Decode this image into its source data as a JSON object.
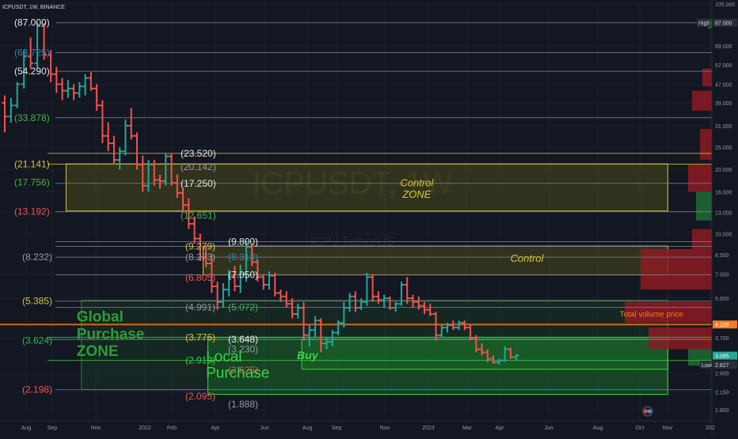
{
  "header": {
    "symbol_line": "ICPUSDT, 1W, BINANCE"
  },
  "watermark": {
    "title": "ICPUSDT, 1W",
    "subtitle": "ICP / TetherUS"
  },
  "colors": {
    "background": "#131722",
    "up": "#26a69a",
    "down": "#ef5350",
    "orange": "#f57c21",
    "yellow": "#d4c53a",
    "green": "#33d13f",
    "white": "#e6e6e6",
    "blue": "#2a8bb0"
  },
  "chart_data": {
    "type": "ohlc",
    "y_scale": "log",
    "ylim": [
      1.8,
      105
    ],
    "x_tick_labels": [
      "Aug",
      "Sep",
      "Nov",
      "2022",
      "Feb",
      "Apr",
      "Jun",
      "Aug",
      "Sep",
      "Nov",
      "2023",
      "Mar",
      "Apr",
      "Jun",
      "Aug",
      "Oct",
      "Nov",
      "202"
    ],
    "y_tick_labels": [
      "105.000",
      "69.000",
      "57.000",
      "47.000",
      "39.000",
      "31.000",
      "25.000",
      "20.000",
      "16.000",
      "13.000",
      "10.500",
      "8.500",
      "7.000",
      "5.500",
      "3.700",
      "2.600",
      "2.150",
      "1.800"
    ],
    "price_tags": [
      {
        "text": "High",
        "value": "87.000",
        "y": 87.0
      },
      {
        "text": "",
        "value": "4.229",
        "y": 4.229
      },
      {
        "text": "",
        "value": "3.095",
        "y": 3.095
      },
      {
        "text": "Low",
        "value": "2.827",
        "y": 2.827
      }
    ],
    "annotations": [
      {
        "text": "Control",
        "x": 5.45,
        "y": 8.2
      },
      {
        "text": "Total volume price",
        "x": 6.75,
        "y": 4.7
      },
      {
        "text": "Control",
        "x": 4.3,
        "y": 17.5
      },
      {
        "text": "ZONE",
        "x": 4.3,
        "y": 15.6
      },
      {
        "text": "Global",
        "x": 0.75,
        "y": 4.6
      },
      {
        "text": "Purchase",
        "x": 0.75,
        "y": 3.86
      },
      {
        "text": "ZONE",
        "x": 0.75,
        "y": 3.25
      },
      {
        "text": "Local",
        "x": 2.1,
        "y": 3.08
      },
      {
        "text": "Purchase",
        "x": 2.1,
        "y": 2.62
      },
      {
        "text": "Buy",
        "x": 3.05,
        "y": 3.11
      }
    ],
    "level_labels": [
      {
        "text": "(87.000)",
        "y": 87.0
      },
      {
        "text": "(63.725)",
        "y": 64.5
      },
      {
        "text": "(54.290)",
        "y": 53.5
      },
      {
        "text": "(33.878)",
        "y": 33.6
      },
      {
        "text": "(21.141)",
        "y": 21.1
      },
      {
        "text": "(17.756)",
        "y": 17.6
      },
      {
        "text": "(13.192)",
        "y": 13.1
      },
      {
        "text": "(8.232)",
        "y": 8.3
      },
      {
        "text": "(5.385)",
        "y": 5.35
      },
      {
        "text": "(3.624)",
        "y": 3.6
      },
      {
        "text": "(2.198)",
        "y": 2.2
      },
      {
        "text": "(23.520)",
        "y": 23.5
      },
      {
        "text": "(20.142)",
        "y": 20.5
      },
      {
        "text": "(17.250)",
        "y": 17.4
      },
      {
        "text": "(12.651)",
        "y": 12.6
      },
      {
        "text": "(9.800)",
        "y": 9.7
      },
      {
        "text": "(9.279)",
        "y": 9.25
      },
      {
        "text": "(8.273)",
        "y": 8.3
      },
      {
        "text": "(8.313)",
        "y": 8.3
      },
      {
        "text": "(7.050)",
        "y": 6.95
      },
      {
        "text": "(6.805)",
        "y": 6.75
      },
      {
        "text": "(4.991)",
        "y": 5.02
      },
      {
        "text": "(5.072)",
        "y": 5.02
      },
      {
        "text": "(3.776)",
        "y": 3.72
      },
      {
        "text": "(3.648)",
        "y": 3.64
      },
      {
        "text": "(3.230)",
        "y": 3.3
      },
      {
        "text": "(2.910)",
        "y": 2.95
      },
      {
        "text": "(2.625)",
        "y": 2.68
      },
      {
        "text": "(2.095)",
        "y": 2.06
      },
      {
        "text": "(1.888)",
        "y": 1.9
      }
    ],
    "levels": [
      87.0,
      64.5,
      53.5,
      33.6,
      23.5,
      21.1,
      17.4,
      13.1,
      9.7,
      9.25,
      8.3,
      6.95,
      5.35,
      5.02,
      4.229,
      3.72,
      3.64,
      2.95,
      2.2
    ],
    "zones": [
      {
        "x0": 0.64,
        "x1": 6.92,
        "y_high": 21.14,
        "y_low": 13.19,
        "color": "yellow"
      },
      {
        "x0": 2.07,
        "x1": 6.92,
        "y_high": 9.28,
        "y_low": 6.95,
        "color": "yellow"
      },
      {
        "x0": 0.8,
        "x1": 6.92,
        "y_high": 5.385,
        "y_low": 2.2,
        "color": "green-dark"
      },
      {
        "x0": 2.12,
        "x1": 6.92,
        "y_high": 3.72,
        "y_low": 2.1,
        "color": "green"
      },
      {
        "x0": 3.1,
        "x1": 6.92,
        "y_high": 3.65,
        "y_low": 2.7,
        "color": "green"
      }
    ],
    "volume_profile": [
      {
        "y_low": 82,
        "y_high": 90,
        "width": 5,
        "up": true
      },
      {
        "y_low": 46,
        "y_high": 55,
        "width": 12,
        "up": false
      },
      {
        "y_low": 36,
        "y_high": 44,
        "width": 25,
        "up": false
      },
      {
        "y_low": 22,
        "y_high": 30,
        "width": 15,
        "up": false
      },
      {
        "y_low": 16,
        "y_high": 21,
        "width": 30,
        "up": false
      },
      {
        "y_low": 12,
        "y_high": 16,
        "width": 20,
        "up": true
      },
      {
        "y_low": 9,
        "y_high": 11,
        "width": 25,
        "up": false
      },
      {
        "y_low": 6,
        "y_high": 9,
        "width": 90,
        "up": false
      },
      {
        "y_low": 4.3,
        "y_high": 5.3,
        "width": 110,
        "up": false
      },
      {
        "y_low": 3.3,
        "y_high": 4.1,
        "width": 80,
        "up": false
      },
      {
        "y_low": 2.8,
        "y_high": 3.3,
        "width": 30,
        "up": true
      }
    ],
    "bars": [
      [
        0,
        39,
        42,
        29,
        34
      ],
      [
        0.065,
        34,
        41,
        32,
        38
      ],
      [
        0.13,
        38,
        48,
        37,
        47
      ],
      [
        0.2,
        47,
        66,
        45,
        62
      ],
      [
        0.27,
        62,
        75,
        55,
        58
      ],
      [
        0.34,
        58,
        87,
        55,
        84
      ],
      [
        0.41,
        84,
        87,
        60,
        63
      ],
      [
        0.48,
        63,
        66,
        48,
        52
      ],
      [
        0.54,
        52,
        56,
        43,
        47
      ],
      [
        0.6,
        47,
        50,
        40,
        44
      ],
      [
        0.66,
        44,
        49,
        41,
        45
      ],
      [
        0.72,
        45,
        47,
        40,
        43
      ],
      [
        0.78,
        43,
        48,
        41,
        46
      ],
      [
        0.84,
        46,
        52,
        42,
        50
      ],
      [
        0.9,
        50,
        53,
        44,
        45
      ],
      [
        0.96,
        45,
        47,
        36,
        38
      ],
      [
        1.02,
        38,
        40,
        26,
        28
      ],
      [
        1.08,
        28,
        32,
        24,
        26
      ],
      [
        1.14,
        26,
        28,
        21,
        22
      ],
      [
        1.2,
        22,
        25,
        20,
        24
      ],
      [
        1.26,
        24,
        33,
        23,
        31
      ],
      [
        1.32,
        31,
        37,
        27,
        28
      ],
      [
        1.38,
        28,
        29,
        20,
        21
      ],
      [
        1.44,
        21,
        23,
        16,
        17
      ],
      [
        1.5,
        17,
        22,
        16,
        21
      ],
      [
        1.56,
        21,
        22,
        17,
        18
      ],
      [
        1.62,
        18,
        19,
        16.5,
        17.8
      ],
      [
        1.68,
        17.8,
        23.5,
        17,
        22.8
      ],
      [
        1.74,
        22.8,
        23.5,
        17,
        17.5
      ],
      [
        1.8,
        17.5,
        19,
        15,
        15.8
      ],
      [
        1.86,
        15.8,
        16.5,
        13,
        14
      ],
      [
        1.92,
        14,
        15,
        11,
        11.6
      ],
      [
        1.98,
        11.6,
        12.5,
        9.5,
        10
      ],
      [
        2.04,
        10,
        10.5,
        8,
        8.3
      ],
      [
        2.1,
        8.3,
        9.3,
        7.5,
        7.8
      ],
      [
        2.16,
        7.8,
        8.5,
        5.8,
        6.2
      ],
      [
        2.22,
        6.2,
        6.5,
        4.9,
        5.3
      ],
      [
        2.28,
        5.3,
        6.4,
        5.0,
        6.0
      ],
      [
        2.34,
        6.0,
        7.3,
        5.6,
        6.8
      ],
      [
        2.4,
        6.8,
        7.6,
        5.9,
        6.2
      ],
      [
        2.46,
        6.2,
        7.7,
        5.8,
        7.0
      ],
      [
        2.52,
        7.0,
        9.8,
        6.5,
        9.2
      ],
      [
        2.58,
        9.2,
        9.5,
        7.6,
        7.9
      ],
      [
        2.64,
        7.9,
        8.1,
        6.5,
        6.8
      ],
      [
        2.7,
        6.8,
        7.0,
        6.0,
        6.3
      ],
      [
        2.76,
        6.3,
        7.2,
        6.0,
        6.9
      ],
      [
        2.82,
        6.9,
        7.1,
        5.6,
        5.8
      ],
      [
        2.88,
        5.8,
        6.0,
        5.3,
        5.6
      ],
      [
        2.94,
        5.6,
        5.9,
        5.0,
        5.2
      ],
      [
        3.0,
        5.2,
        5.5,
        4.5,
        4.7
      ],
      [
        3.06,
        4.7,
        5.2,
        4.5,
        5.0
      ],
      [
        3.12,
        5.0,
        5.3,
        3.6,
        3.8
      ],
      [
        3.18,
        3.8,
        4.2,
        3.4,
        4.0
      ],
      [
        3.24,
        4.0,
        4.6,
        3.7,
        4.4
      ],
      [
        3.3,
        4.4,
        4.5,
        3.2,
        3.5
      ],
      [
        3.36,
        3.5,
        3.7,
        3.3,
        3.55
      ],
      [
        3.42,
        3.55,
        4.0,
        3.4,
        3.9
      ],
      [
        3.48,
        3.9,
        4.4,
        3.8,
        4.3
      ],
      [
        3.54,
        4.3,
        5.3,
        4.1,
        5.0
      ],
      [
        3.6,
        5.0,
        5.8,
        4.8,
        5.6
      ],
      [
        3.66,
        5.6,
        5.9,
        4.8,
        5.0
      ],
      [
        3.72,
        5.0,
        5.5,
        4.9,
        5.3
      ],
      [
        3.78,
        5.3,
        7.1,
        5.1,
        6.8
      ],
      [
        3.84,
        6.8,
        7.0,
        5.3,
        5.6
      ],
      [
        3.9,
        5.6,
        5.9,
        5.2,
        5.4
      ],
      [
        3.96,
        5.4,
        5.7,
        5.0,
        5.5
      ],
      [
        4.02,
        5.5,
        5.6,
        4.9,
        5.0
      ],
      [
        4.08,
        5.0,
        5.3,
        4.8,
        5.2
      ],
      [
        4.14,
        5.2,
        6.5,
        5.1,
        6.3
      ],
      [
        4.2,
        6.3,
        6.8,
        5.2,
        5.5
      ],
      [
        4.26,
        5.5,
        5.7,
        5.0,
        5.3
      ],
      [
        4.32,
        5.3,
        5.6,
        4.9,
        5.1
      ],
      [
        4.38,
        5.1,
        5.3,
        4.7,
        4.9
      ],
      [
        4.44,
        4.9,
        5.2,
        4.6,
        4.7
      ],
      [
        4.5,
        4.7,
        4.8,
        3.6,
        3.8
      ],
      [
        4.56,
        3.8,
        4.2,
        3.7,
        4.1
      ],
      [
        4.62,
        4.1,
        4.3,
        3.9,
        4.2
      ],
      [
        4.68,
        4.2,
        4.4,
        4.0,
        4.1
      ],
      [
        4.74,
        4.1,
        4.4,
        4.0,
        4.3
      ],
      [
        4.8,
        4.3,
        4.4,
        4.0,
        4.1
      ],
      [
        4.86,
        4.1,
        4.2,
        3.6,
        3.7
      ],
      [
        4.92,
        3.7,
        3.8,
        3.2,
        3.3
      ],
      [
        4.98,
        3.3,
        3.5,
        3.1,
        3.2
      ],
      [
        5.04,
        3.2,
        3.3,
        2.9,
        3.0
      ],
      [
        5.1,
        3.0,
        3.1,
        2.85,
        2.9
      ],
      [
        5.16,
        2.9,
        3.0,
        2.83,
        2.95
      ],
      [
        5.22,
        2.95,
        3.4,
        2.9,
        3.3
      ],
      [
        5.28,
        3.3,
        3.35,
        3.0,
        3.05
      ],
      [
        5.34,
        3.05,
        3.15,
        2.95,
        3.1
      ]
    ]
  }
}
